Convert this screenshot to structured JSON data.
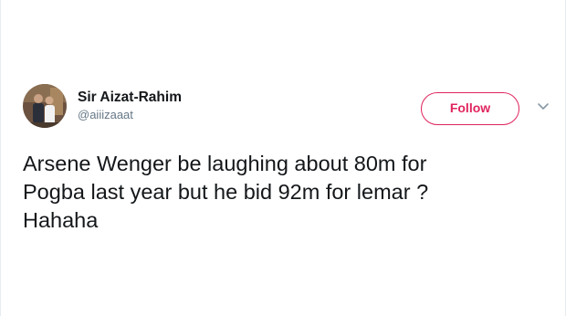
{
  "user": {
    "display_name": "Sir Aizat-Rahim",
    "handle": "@aiiizaaat",
    "avatar_icon": "profile-photo"
  },
  "actions": {
    "follow_label": "Follow",
    "menu_icon": "chevron-down-icon"
  },
  "tweet": {
    "text": "Arsene Wenger be laughing about 80m for\nPogba last year but he bid 92m for lemar ?\nHahaha"
  },
  "colors": {
    "accent": "#e0245e",
    "handle": "#657786",
    "text": "#14171a"
  }
}
